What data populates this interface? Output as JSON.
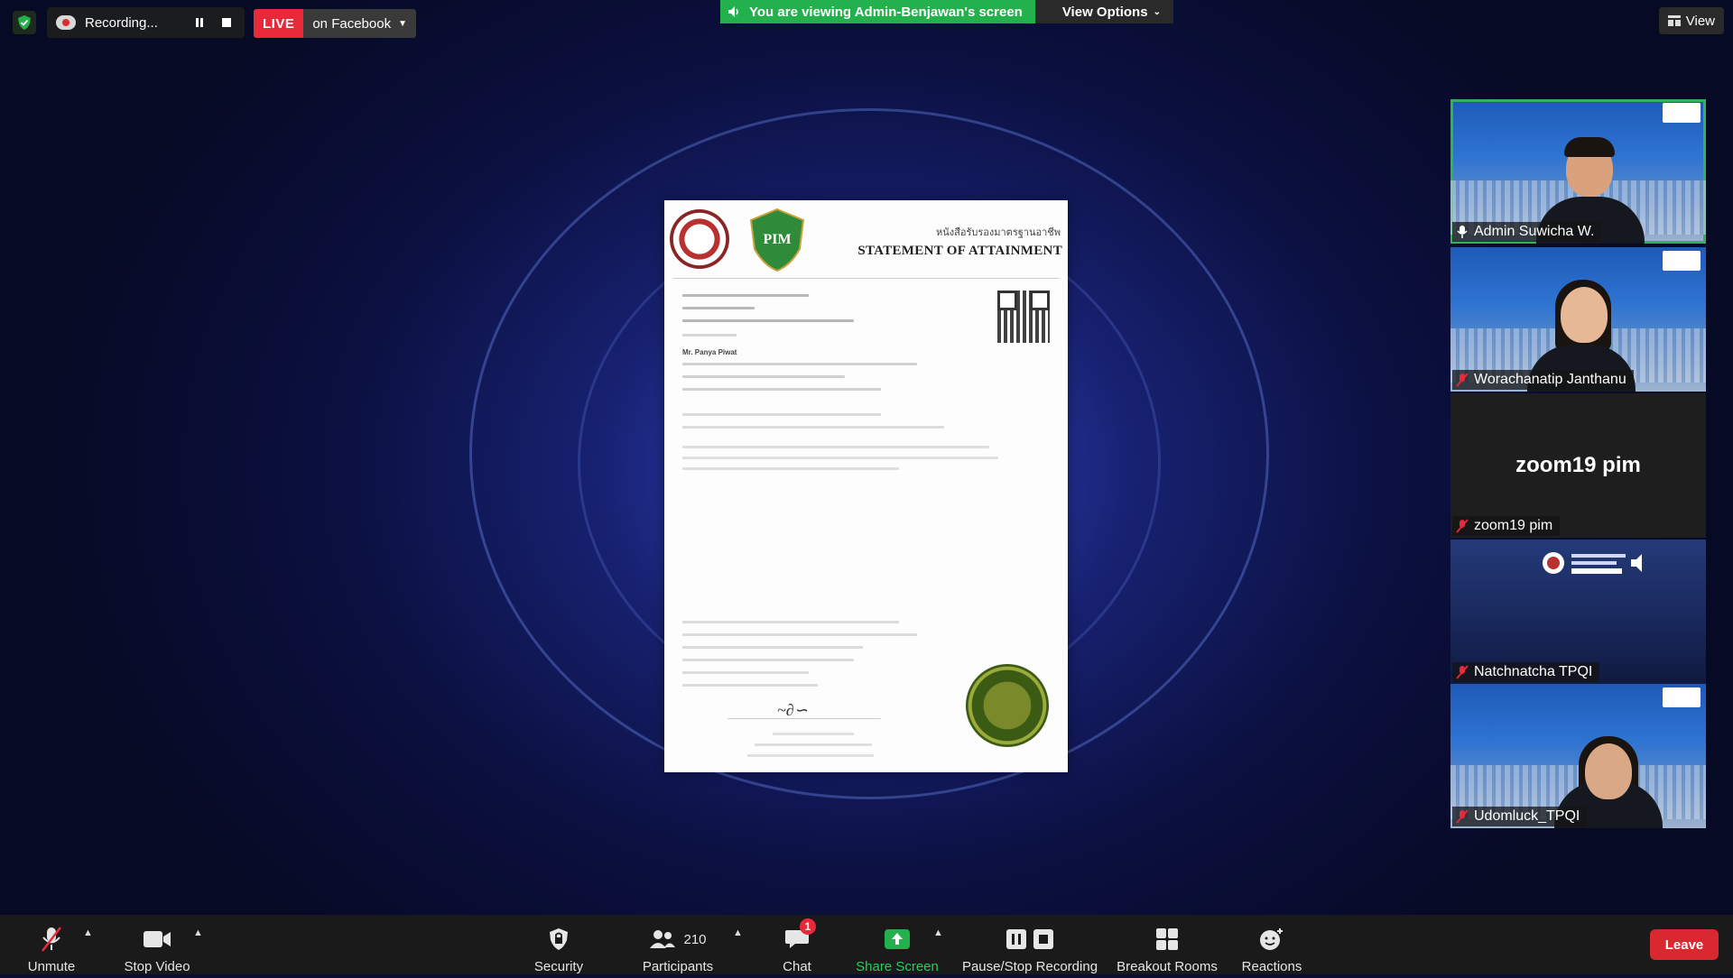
{
  "topbar": {
    "recording_text": "Recording...",
    "live_label": "LIVE",
    "live_destination": "on Facebook",
    "viewing_message": "You are viewing Admin-Benjawan's screen",
    "view_options": "View Options",
    "view_button": "View"
  },
  "shared_document": {
    "header_thai": "หนังสือรับรองมาตรฐานอาชีพ",
    "title": "STATEMENT OF ATTAINMENT",
    "recipient": "Mr. Panya Piwat"
  },
  "participants": [
    {
      "name": "Admin Suwicha W.",
      "muted": false
    },
    {
      "name": "Worachanatip Janthanu",
      "muted": true
    },
    {
      "name": "zoom19 pim",
      "display_text": "zoom19 pim",
      "muted": true
    },
    {
      "name": "Natchnatcha TPQI",
      "muted": true
    },
    {
      "name": "Udomluck_TPQI",
      "muted": true
    }
  ],
  "toolbar": {
    "unmute": "Unmute",
    "stop_video": "Stop Video",
    "security": "Security",
    "participants_label": "Participants",
    "participants_count": "210",
    "chat": "Chat",
    "chat_badge": "1",
    "share_screen": "Share Screen",
    "pause_stop_recording": "Pause/Stop Recording",
    "breakout_rooms": "Breakout Rooms",
    "reactions": "Reactions",
    "leave": "Leave"
  },
  "colors": {
    "accent_green": "#23b14d",
    "live_red": "#e8293a",
    "leave_red": "#d9282f",
    "toolbar_bg": "#1a1a1a"
  }
}
